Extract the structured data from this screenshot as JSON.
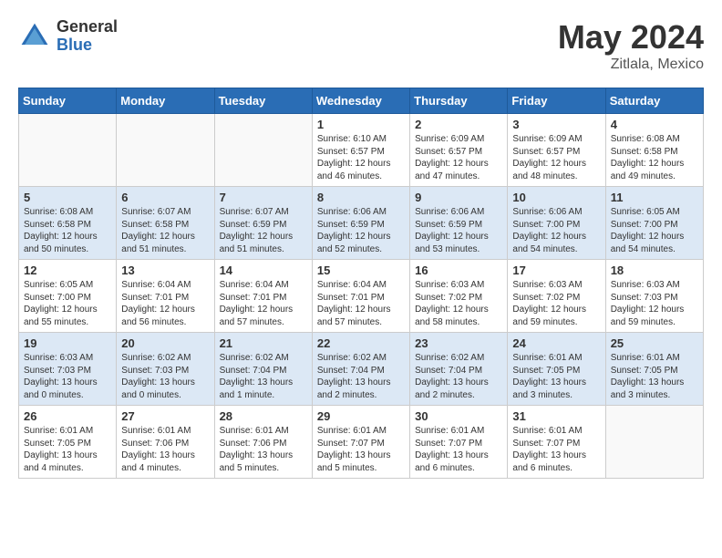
{
  "header": {
    "logo_general": "General",
    "logo_blue": "Blue",
    "month_title": "May 2024",
    "location": "Zitlala, Mexico"
  },
  "days_of_week": [
    "Sunday",
    "Monday",
    "Tuesday",
    "Wednesday",
    "Thursday",
    "Friday",
    "Saturday"
  ],
  "weeks": [
    [
      {
        "day": "",
        "info": ""
      },
      {
        "day": "",
        "info": ""
      },
      {
        "day": "",
        "info": ""
      },
      {
        "day": "1",
        "info": "Sunrise: 6:10 AM\nSunset: 6:57 PM\nDaylight: 12 hours\nand 46 minutes."
      },
      {
        "day": "2",
        "info": "Sunrise: 6:09 AM\nSunset: 6:57 PM\nDaylight: 12 hours\nand 47 minutes."
      },
      {
        "day": "3",
        "info": "Sunrise: 6:09 AM\nSunset: 6:57 PM\nDaylight: 12 hours\nand 48 minutes."
      },
      {
        "day": "4",
        "info": "Sunrise: 6:08 AM\nSunset: 6:58 PM\nDaylight: 12 hours\nand 49 minutes."
      }
    ],
    [
      {
        "day": "5",
        "info": "Sunrise: 6:08 AM\nSunset: 6:58 PM\nDaylight: 12 hours\nand 50 minutes."
      },
      {
        "day": "6",
        "info": "Sunrise: 6:07 AM\nSunset: 6:58 PM\nDaylight: 12 hours\nand 51 minutes."
      },
      {
        "day": "7",
        "info": "Sunrise: 6:07 AM\nSunset: 6:59 PM\nDaylight: 12 hours\nand 51 minutes."
      },
      {
        "day": "8",
        "info": "Sunrise: 6:06 AM\nSunset: 6:59 PM\nDaylight: 12 hours\nand 52 minutes."
      },
      {
        "day": "9",
        "info": "Sunrise: 6:06 AM\nSunset: 6:59 PM\nDaylight: 12 hours\nand 53 minutes."
      },
      {
        "day": "10",
        "info": "Sunrise: 6:06 AM\nSunset: 7:00 PM\nDaylight: 12 hours\nand 54 minutes."
      },
      {
        "day": "11",
        "info": "Sunrise: 6:05 AM\nSunset: 7:00 PM\nDaylight: 12 hours\nand 54 minutes."
      }
    ],
    [
      {
        "day": "12",
        "info": "Sunrise: 6:05 AM\nSunset: 7:00 PM\nDaylight: 12 hours\nand 55 minutes."
      },
      {
        "day": "13",
        "info": "Sunrise: 6:04 AM\nSunset: 7:01 PM\nDaylight: 12 hours\nand 56 minutes."
      },
      {
        "day": "14",
        "info": "Sunrise: 6:04 AM\nSunset: 7:01 PM\nDaylight: 12 hours\nand 57 minutes."
      },
      {
        "day": "15",
        "info": "Sunrise: 6:04 AM\nSunset: 7:01 PM\nDaylight: 12 hours\nand 57 minutes."
      },
      {
        "day": "16",
        "info": "Sunrise: 6:03 AM\nSunset: 7:02 PM\nDaylight: 12 hours\nand 58 minutes."
      },
      {
        "day": "17",
        "info": "Sunrise: 6:03 AM\nSunset: 7:02 PM\nDaylight: 12 hours\nand 59 minutes."
      },
      {
        "day": "18",
        "info": "Sunrise: 6:03 AM\nSunset: 7:03 PM\nDaylight: 12 hours\nand 59 minutes."
      }
    ],
    [
      {
        "day": "19",
        "info": "Sunrise: 6:03 AM\nSunset: 7:03 PM\nDaylight: 13 hours\nand 0 minutes."
      },
      {
        "day": "20",
        "info": "Sunrise: 6:02 AM\nSunset: 7:03 PM\nDaylight: 13 hours\nand 0 minutes."
      },
      {
        "day": "21",
        "info": "Sunrise: 6:02 AM\nSunset: 7:04 PM\nDaylight: 13 hours\nand 1 minute."
      },
      {
        "day": "22",
        "info": "Sunrise: 6:02 AM\nSunset: 7:04 PM\nDaylight: 13 hours\nand 2 minutes."
      },
      {
        "day": "23",
        "info": "Sunrise: 6:02 AM\nSunset: 7:04 PM\nDaylight: 13 hours\nand 2 minutes."
      },
      {
        "day": "24",
        "info": "Sunrise: 6:01 AM\nSunset: 7:05 PM\nDaylight: 13 hours\nand 3 minutes."
      },
      {
        "day": "25",
        "info": "Sunrise: 6:01 AM\nSunset: 7:05 PM\nDaylight: 13 hours\nand 3 minutes."
      }
    ],
    [
      {
        "day": "26",
        "info": "Sunrise: 6:01 AM\nSunset: 7:05 PM\nDaylight: 13 hours\nand 4 minutes."
      },
      {
        "day": "27",
        "info": "Sunrise: 6:01 AM\nSunset: 7:06 PM\nDaylight: 13 hours\nand 4 minutes."
      },
      {
        "day": "28",
        "info": "Sunrise: 6:01 AM\nSunset: 7:06 PM\nDaylight: 13 hours\nand 5 minutes."
      },
      {
        "day": "29",
        "info": "Sunrise: 6:01 AM\nSunset: 7:07 PM\nDaylight: 13 hours\nand 5 minutes."
      },
      {
        "day": "30",
        "info": "Sunrise: 6:01 AM\nSunset: 7:07 PM\nDaylight: 13 hours\nand 6 minutes."
      },
      {
        "day": "31",
        "info": "Sunrise: 6:01 AM\nSunset: 7:07 PM\nDaylight: 13 hours\nand 6 minutes."
      },
      {
        "day": "",
        "info": ""
      }
    ]
  ]
}
